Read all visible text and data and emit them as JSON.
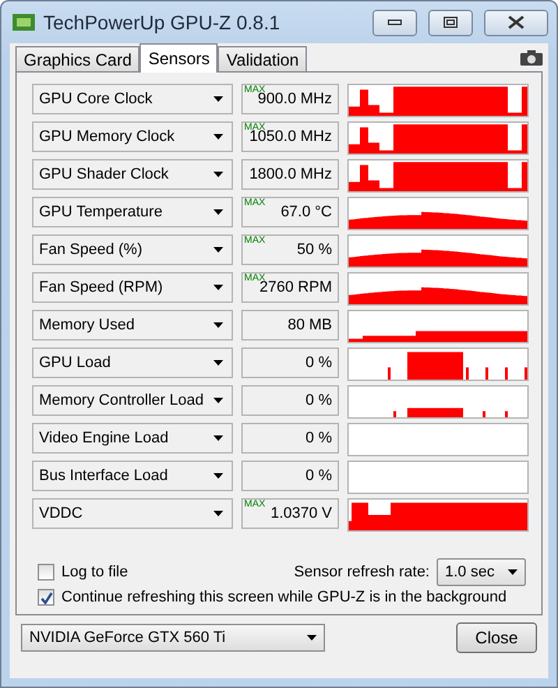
{
  "window": {
    "title": "TechPowerUp GPU-Z 0.8.1"
  },
  "tabs": [
    {
      "label": "Graphics Card",
      "selected": false
    },
    {
      "label": "Sensors",
      "selected": true
    },
    {
      "label": "Validation",
      "selected": false
    }
  ],
  "sensors": [
    {
      "name": "GPU Core Clock",
      "value": "900.0 MHz",
      "max_label": "MAX",
      "kind": "clock"
    },
    {
      "name": "GPU Memory Clock",
      "value": "1050.0 MHz",
      "max_label": "MAX",
      "kind": "clock"
    },
    {
      "name": "GPU Shader Clock",
      "value": "1800.0 MHz",
      "kind": "clock"
    },
    {
      "name": "GPU Temperature",
      "value": "67.0 °C",
      "max_label": "MAX",
      "kind": "wave"
    },
    {
      "name": "Fan Speed (%)",
      "value": "50 %",
      "max_label": "MAX",
      "kind": "wave"
    },
    {
      "name": "Fan Speed (RPM)",
      "value": "2760 RPM",
      "max_label": "MAX",
      "kind": "wave"
    },
    {
      "name": "Memory Used",
      "value": "80 MB",
      "kind": "memory"
    },
    {
      "name": "GPU Load",
      "value": "0 %",
      "kind": "load"
    },
    {
      "name": "Memory Controller Load",
      "value": "0 %",
      "kind": "lowload"
    },
    {
      "name": "Video Engine Load",
      "value": "0 %",
      "kind": "flat"
    },
    {
      "name": "Bus Interface Load",
      "value": "0 %",
      "kind": "flat"
    },
    {
      "name": "VDDC",
      "value": "1.0370 V",
      "max_label": "MAX",
      "kind": "voltage"
    }
  ],
  "log_to_file": {
    "label": "Log to file",
    "checked": false
  },
  "refresh_rate": {
    "label": "Sensor refresh rate:",
    "value": "1.0 sec"
  },
  "continue_refreshing": {
    "label": "Continue refreshing this screen while GPU-Z is in the background",
    "checked": true
  },
  "device": {
    "value": "NVIDIA GeForce GTX 560 Ti"
  },
  "close_button": "Close"
}
